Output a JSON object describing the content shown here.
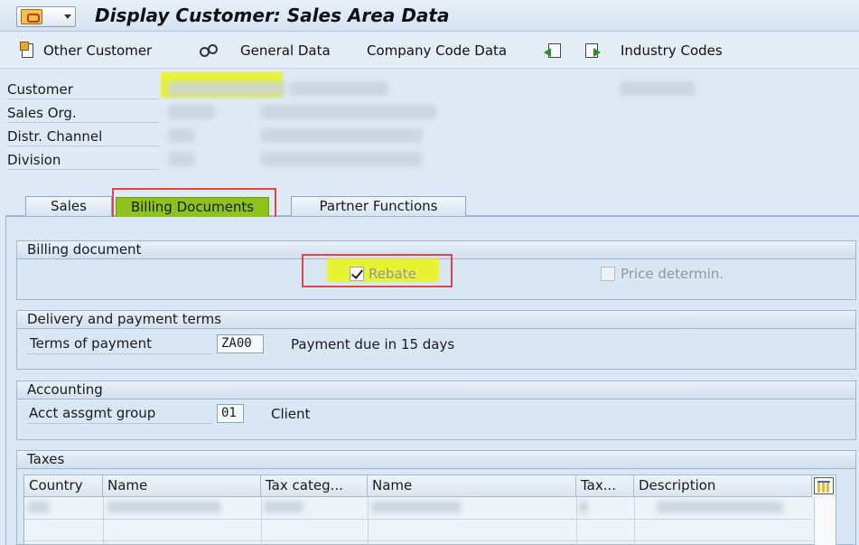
{
  "window": {
    "title": "Display Customer: Sales Area Data"
  },
  "toolbar": {
    "other_customer": "Other Customer",
    "general_data": "General Data",
    "company_code_data": "Company Code Data",
    "industry_codes": "Industry Codes"
  },
  "header": {
    "labels": [
      "Customer",
      "Sales Org.",
      "Distr. Channel",
      "Division"
    ]
  },
  "tabs": [
    {
      "label": "Sales",
      "active": false
    },
    {
      "label": "Billing Documents",
      "active": true
    },
    {
      "label": "Partner Functions",
      "active": false
    }
  ],
  "billing": {
    "title": "Billing document",
    "rebate_label": "Rebate",
    "rebate_checked": true,
    "price_label": "Price determin.",
    "price_checked": false
  },
  "delivery": {
    "title": "Delivery and payment terms",
    "terms_label": "Terms of payment",
    "terms_value": "ZA00",
    "terms_desc": "Payment due in 15 days"
  },
  "accounting": {
    "title": "Accounting",
    "acct_label": "Acct assgmt group",
    "acct_value": "01",
    "acct_desc": "Client"
  },
  "taxes": {
    "title": "Taxes",
    "columns": [
      "Country",
      "Name",
      "Tax categ...",
      "Name",
      "Tax...",
      "Description"
    ]
  },
  "colors": {
    "highlight": "#e8f231",
    "active_tab": "#8ec21f",
    "annotation_box": "#e0454a"
  }
}
